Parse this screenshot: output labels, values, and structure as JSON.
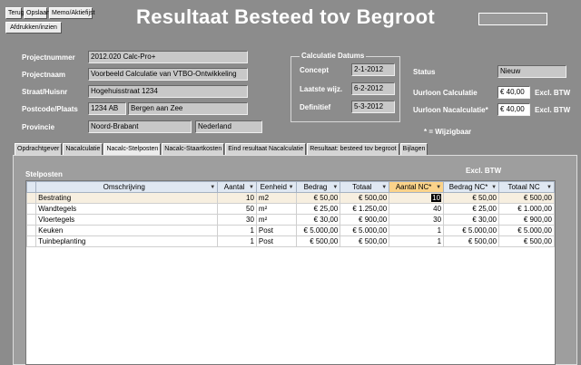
{
  "toolbar": {
    "terug": "Terug",
    "opslaan": "Opslaan",
    "memo": "Memo/Aktiefijst",
    "afdrukken": "Afdrukken/inzien"
  },
  "title": "Resultaat Besteed tov Begroot",
  "project": {
    "nummer_label": "Projectnummer",
    "nummer": "2012.020 Calc-Pro+",
    "naam_label": "Projectnaam",
    "naam": "Voorbeeld Calculatie van VTBO-Ontwikkeling",
    "straat_label": "Straat/Huisnr",
    "straat": "Hogehuisstraat 1234",
    "postcode_label": "Postcode/Plaats",
    "postcode": "1234 AB",
    "plaats": "Bergen aan Zee",
    "provincie_label": "Provincie",
    "provincie": "Noord-Brabant",
    "land": "Nederland"
  },
  "datums": {
    "legend": "Calculatie Datums",
    "concept_label": "Concept",
    "concept": "2-1-2012",
    "laatste_label": "Laatste wijz.",
    "laatste": "6-2-2012",
    "definitief_label": "Definitief",
    "definitief": "5-3-2012"
  },
  "status": {
    "status_label": "Status",
    "status": "Nieuw",
    "uurloon_calc_label": "Uurloon Calculatie",
    "uurloon_calc": "€ 40,00",
    "excl1": "Excl. BTW",
    "uurloon_nacalc_label": "Uurloon Nacalculatie*",
    "uurloon_nacalc": "€ 40,00",
    "excl2": "Excl. BTW",
    "wijzigbaar": "* = Wijzigbaar"
  },
  "tabs": [
    "Opdrachtgever",
    "Nacalculatie",
    "Nacalc-Stelposten",
    "Nacalc-Staartkosten",
    "Eind resultaat Nacalculatie",
    "Resultaat: besteed tov begroot",
    "Bijlagen"
  ],
  "active_tab": 2,
  "section": {
    "title": "Stelposten",
    "excl": "Excl. BTW"
  },
  "table": {
    "headers": [
      "Omschrijving",
      "Aantal",
      "Eenheid",
      "Bedrag",
      "Totaal",
      "Aantal NC*",
      "Bedrag NC*",
      "Totaal NC"
    ],
    "rows": [
      [
        "Bestrating",
        "10",
        "m2",
        "€ 50,00",
        "€ 500,00",
        "10",
        "€ 50,00",
        "€ 500,00"
      ],
      [
        "Wandtegels",
        "50",
        "m²",
        "€ 25,00",
        "€ 1.250,00",
        "40",
        "€ 25,00",
        "€ 1.000,00"
      ],
      [
        "Vloertegels",
        "30",
        "m²",
        "€ 30,00",
        "€ 900,00",
        "30",
        "€ 30,00",
        "€ 900,00"
      ],
      [
        "Keuken",
        "1",
        "Post",
        "€ 5.000,00",
        "€ 5.000,00",
        "1",
        "€ 5.000,00",
        "€ 5.000,00"
      ],
      [
        "Tuinbeplanting",
        "1",
        "Post",
        "€ 500,00",
        "€ 500,00",
        "1",
        "€ 500,00",
        "€ 500,00"
      ]
    ]
  },
  "colors": {
    "background": "#8c8c8c",
    "header_accent": "#fbd38a"
  }
}
